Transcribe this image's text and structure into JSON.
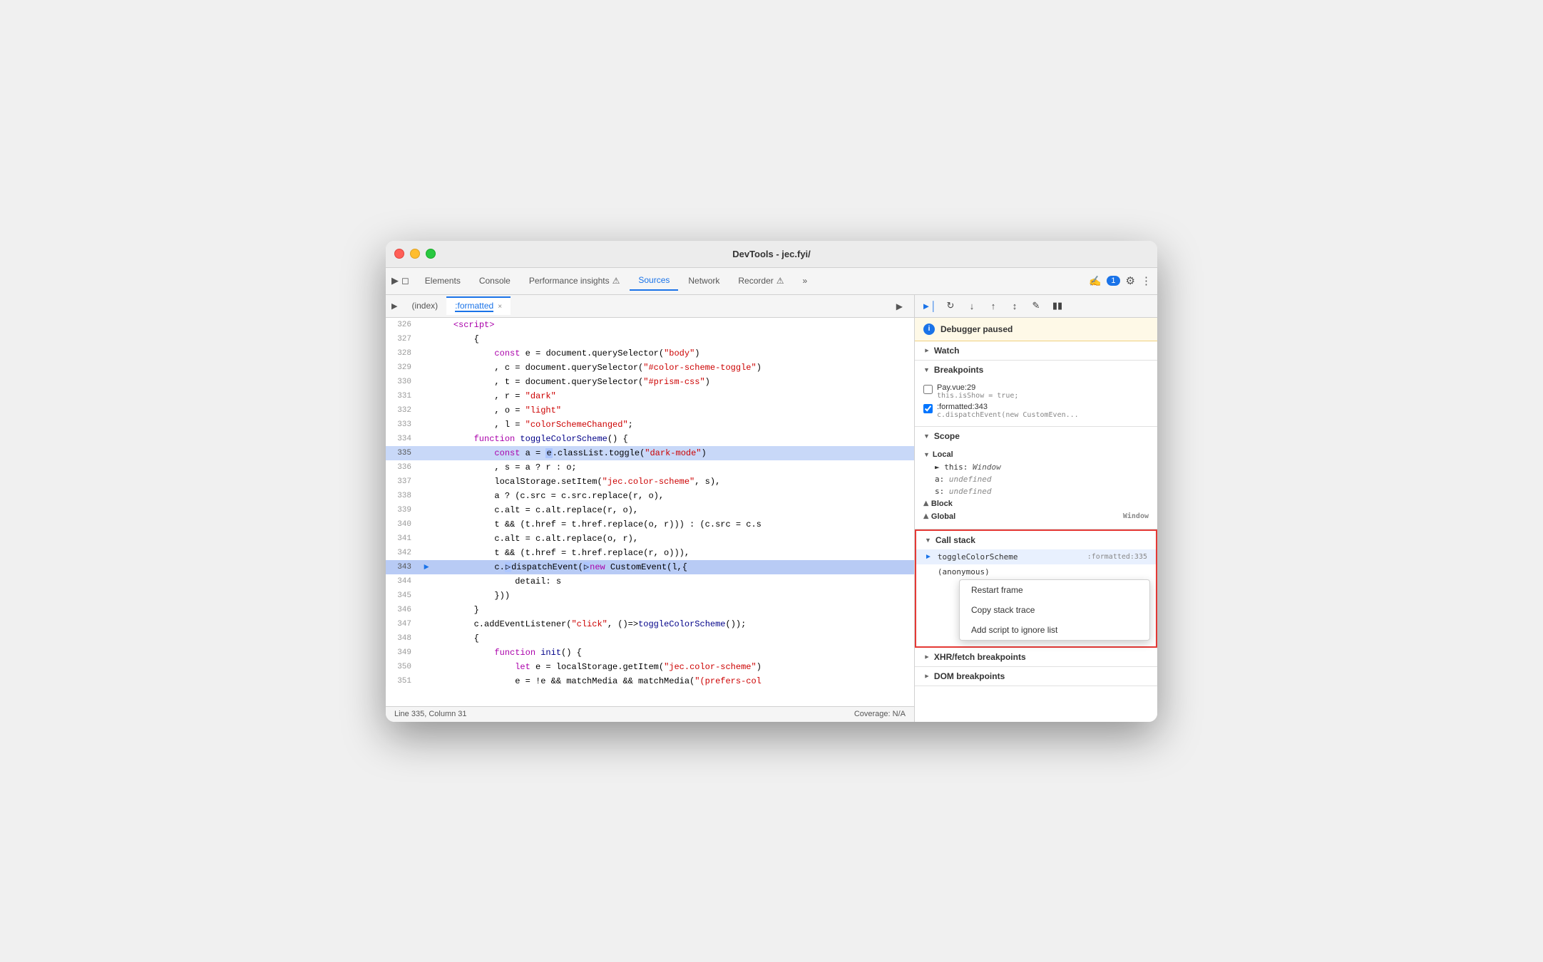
{
  "window": {
    "title": "DevTools - jec.fyi/"
  },
  "tabs": {
    "items": [
      {
        "label": "Elements",
        "active": false
      },
      {
        "label": "Console",
        "active": false
      },
      {
        "label": "Performance insights",
        "active": false,
        "icon": "⚠"
      },
      {
        "label": "Sources",
        "active": true
      },
      {
        "label": "Network",
        "active": false
      },
      {
        "label": "Recorder",
        "active": false,
        "icon": "⚠"
      },
      {
        "label": "»",
        "active": false
      }
    ],
    "badge": "1",
    "settings_icon": "⚙",
    "more_icon": "⋮"
  },
  "file_tabs": {
    "index": "(index)",
    "formatted": ":formatted",
    "close_label": "×"
  },
  "code": {
    "lines": [
      {
        "num": 326,
        "text": "    <script>",
        "highlight": false
      },
      {
        "num": 327,
        "text": "        {",
        "highlight": false
      },
      {
        "num": 328,
        "text": "            const e = document.querySelector(\"body\")",
        "highlight": false
      },
      {
        "num": 329,
        "text": "            , c = document.querySelector(\"#color-scheme-toggle\")",
        "highlight": false
      },
      {
        "num": 330,
        "text": "            , t = document.querySelector(\"#prism-css\")",
        "highlight": false
      },
      {
        "num": 331,
        "text": "            , r = \"dark\"",
        "highlight": false
      },
      {
        "num": 332,
        "text": "            , o = \"light\"",
        "highlight": false
      },
      {
        "num": 333,
        "text": "            , l = \"colorSchemeChanged\";",
        "highlight": false
      },
      {
        "num": 334,
        "text": "        function toggleColorScheme() {",
        "highlight": false
      },
      {
        "num": 335,
        "text": "            const a = e.classList.toggle(\"dark-mode\")",
        "highlight": true
      },
      {
        "num": 336,
        "text": "            , s = a ? r : o;",
        "highlight": false
      },
      {
        "num": 337,
        "text": "            localStorage.setItem(\"jec.color-scheme\", s),",
        "highlight": false
      },
      {
        "num": 338,
        "text": "            a ? (c.src = c.src.replace(r, o),",
        "highlight": false
      },
      {
        "num": 339,
        "text": "            c.alt = c.alt.replace(r, o),",
        "highlight": false
      },
      {
        "num": 340,
        "text": "            t && (t.href = t.href.replace(o, r))) : (c.src = c.s",
        "highlight": false
      },
      {
        "num": 341,
        "text": "            c.alt = c.alt.replace(o, r),",
        "highlight": false
      },
      {
        "num": 342,
        "text": "            t && (t.href = t.href.replace(r, o))),",
        "highlight": false
      },
      {
        "num": 343,
        "text": "            c.dispatchEvent(new CustomEvent(l,{",
        "highlight": false,
        "pause": true
      },
      {
        "num": 344,
        "text": "                detail: s",
        "highlight": false
      },
      {
        "num": 345,
        "text": "            }))",
        "highlight": false
      },
      {
        "num": 346,
        "text": "        }",
        "highlight": false
      },
      {
        "num": 347,
        "text": "        c.addEventListener(\"click\", ()=>toggleColorScheme());",
        "highlight": false
      },
      {
        "num": 348,
        "text": "        {",
        "highlight": false
      },
      {
        "num": 349,
        "text": "            function init() {",
        "highlight": false
      },
      {
        "num": 350,
        "text": "                let e = localStorage.getItem(\"jec.color-scheme\")",
        "highlight": false
      },
      {
        "num": 351,
        "text": "                e = !e && matchMedia && matchMedia(\"(prefers-col",
        "highlight": false
      }
    ]
  },
  "status_bar": {
    "position": "Line 335, Column 31",
    "coverage": "Coverage: N/A"
  },
  "debugger": {
    "paused_message": "Debugger paused",
    "toolbar_buttons": [
      "▶",
      "↺",
      "↓",
      "↑",
      "↕",
      "✏",
      "⏸"
    ]
  },
  "watch": {
    "label": "Watch"
  },
  "breakpoints": {
    "label": "Breakpoints",
    "items": [
      {
        "checked": false,
        "location": "Pay.vue:29",
        "code": "this.isShow = true;"
      },
      {
        "checked": true,
        "location": ":formatted:343",
        "code": "c.dispatchEvent(new CustomEven..."
      }
    ]
  },
  "scope": {
    "label": "Scope",
    "local": {
      "label": "Local",
      "items": [
        {
          "key": "► this",
          "val": "Window"
        },
        {
          "key": "a:",
          "val": "undefined"
        },
        {
          "key": "s:",
          "val": "undefined"
        }
      ]
    },
    "block": {
      "label": "Block"
    },
    "global": {
      "label": "Global",
      "val": "Window"
    }
  },
  "call_stack": {
    "label": "Call stack",
    "items": [
      {
        "name": "toggleColorScheme",
        "location": ":formatted:335",
        "active": true
      },
      {
        "name": "(anonymous)",
        "location": ""
      }
    ]
  },
  "context_menu": {
    "items": [
      {
        "label": "Restart frame"
      },
      {
        "label": "Copy stack trace"
      },
      {
        "label": "Add script to ignore list"
      }
    ]
  },
  "xhr_breakpoints": {
    "label": "XHR/fetch breakpoints"
  },
  "dom_breakpoints": {
    "label": "DOM breakpoints"
  }
}
